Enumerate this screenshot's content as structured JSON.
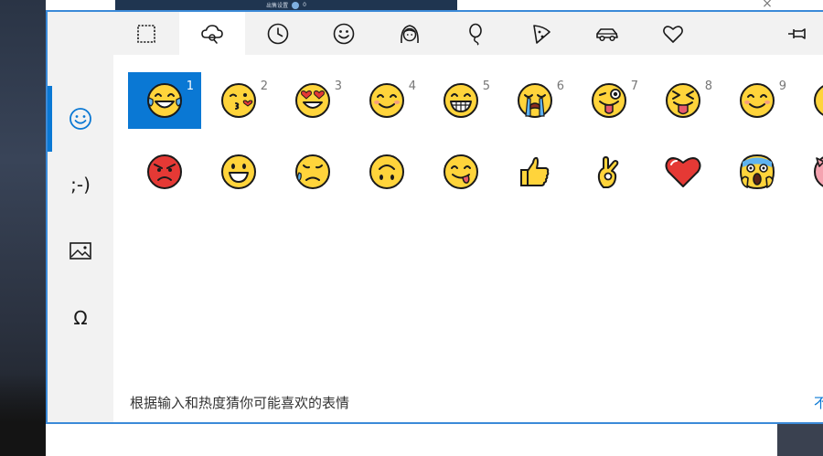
{
  "background": {
    "strip_text": "出售设置",
    "strip_count": "0"
  },
  "rail": [
    {
      "name": "emoji",
      "icon": "smiley-outline-icon"
    },
    {
      "name": "kaomoji",
      "label": ";-)"
    },
    {
      "name": "gif",
      "icon": "image-icon"
    },
    {
      "name": "symbols",
      "label": "Ω"
    }
  ],
  "tabs": [
    {
      "icon": "recent-frame-icon"
    },
    {
      "icon": "smart-suggestion-icon"
    },
    {
      "icon": "clock-icon"
    },
    {
      "icon": "smiley-icon"
    },
    {
      "icon": "person-icon"
    },
    {
      "icon": "balloon-icon"
    },
    {
      "icon": "pizza-icon"
    },
    {
      "icon": "car-icon"
    },
    {
      "icon": "heart-icon"
    }
  ],
  "pin_icon": "pin-icon",
  "emojis_row1": [
    {
      "num": "1",
      "emoji": "face-with-tears-of-joy"
    },
    {
      "num": "2",
      "emoji": "face-blowing-a-kiss"
    },
    {
      "num": "3",
      "emoji": "smiling-face-with-heart-eyes"
    },
    {
      "num": "4",
      "emoji": "smiling-face-with-smiling-eyes"
    },
    {
      "num": "5",
      "emoji": "beaming-face-with-smiling-eyes"
    },
    {
      "num": "6",
      "emoji": "loudly-crying-face"
    },
    {
      "num": "7",
      "emoji": "winking-face-with-tongue"
    },
    {
      "num": "8",
      "emoji": "squinting-face-with-tongue"
    },
    {
      "num": "9",
      "emoji": "smiling-face-with-smiling-eyes"
    }
  ],
  "emojis_row2": [
    {
      "emoji": "pouting-face"
    },
    {
      "emoji": "grinning-face"
    },
    {
      "emoji": "sad-but-relieved-face"
    },
    {
      "emoji": "upside-down-face"
    },
    {
      "emoji": "face-savoring-food"
    },
    {
      "emoji": "thumbs-up"
    },
    {
      "emoji": "ok-hand"
    },
    {
      "emoji": "red-heart"
    },
    {
      "emoji": "face-screaming-in-fear"
    },
    {
      "emoji": "pig-face"
    }
  ],
  "hint_text": "根据输入和热度猜你可能喜欢的表情",
  "hint_link": "不",
  "colors": {
    "accent": "#0a78d4",
    "panel_border": "#3b8ad8",
    "emoji_yellow": "#ffd43b",
    "emoji_red": "#e53935"
  }
}
